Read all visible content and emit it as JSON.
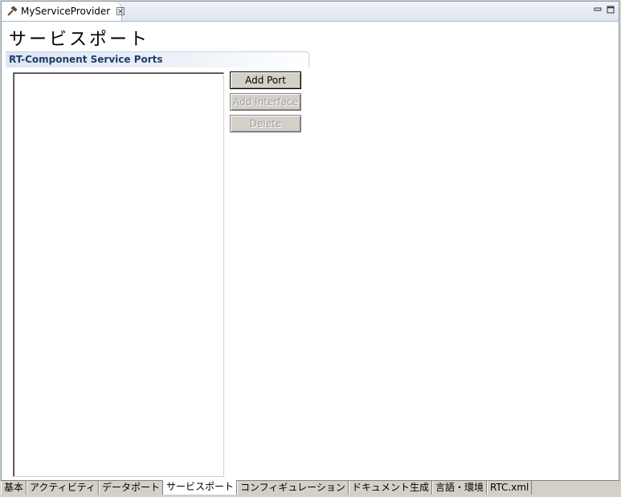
{
  "editor": {
    "tab_title": "MyServiceProvider",
    "tab_icon": "hammer-icon"
  },
  "page": {
    "title": "サービスポート"
  },
  "section": {
    "title": "RT-Component Service Ports"
  },
  "buttons": {
    "add_port": "Add Port",
    "add_interface": "Add Interface",
    "delete": "Delete"
  },
  "bottom_tabs": [
    {
      "label": "基本",
      "active": false
    },
    {
      "label": "アクティビティ",
      "active": false
    },
    {
      "label": "データポート",
      "active": false
    },
    {
      "label": "サービスポート",
      "active": true
    },
    {
      "label": "コンフィギュレーション",
      "active": false
    },
    {
      "label": "ドキュメント生成",
      "active": false
    },
    {
      "label": "言語・環境",
      "active": false
    },
    {
      "label": "RTC.xml",
      "active": false
    }
  ],
  "colors": {
    "section_title": "#1f3c6e",
    "tab_border": "#a6b6cc"
  }
}
